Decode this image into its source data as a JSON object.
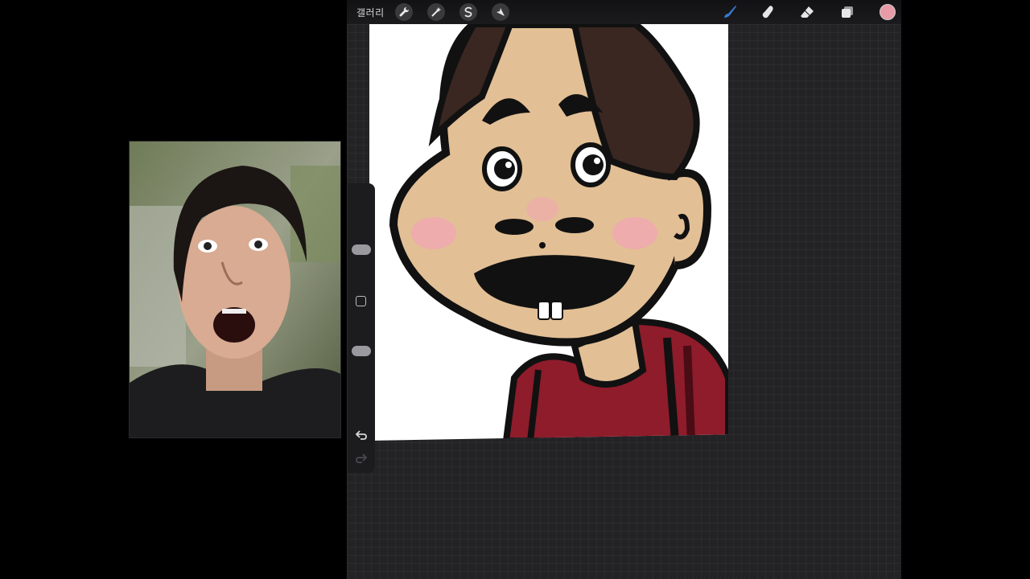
{
  "toolbar": {
    "gallery_label": "갤러리",
    "left_tools": [
      {
        "name": "actions",
        "icon": "wrench-icon"
      },
      {
        "name": "adjustments",
        "icon": "magic-wand-icon"
      },
      {
        "name": "selection",
        "icon": "selection-s-icon"
      },
      {
        "name": "transform",
        "icon": "arrow-cursor-icon"
      }
    ],
    "right_tools": [
      {
        "name": "brush",
        "icon": "brush-icon",
        "active": true
      },
      {
        "name": "smudge",
        "icon": "smudge-icon"
      },
      {
        "name": "eraser",
        "icon": "eraser-icon"
      },
      {
        "name": "layers",
        "icon": "layers-icon"
      }
    ],
    "active_color": "#e89aa6",
    "active_tool_color": "#3a7bd5"
  },
  "sidebar": {
    "brush_size_level": 0.73,
    "opacity_level": 0.35,
    "icons": [
      "modify-square-icon",
      "undo-icon",
      "redo-icon"
    ]
  },
  "canvas": {
    "background": "#ffffff",
    "skin_color": "#e2bf95",
    "hair_color": "#3a2722",
    "shirt_color": "#8e1c2b",
    "blush_color": "#f1a8b1"
  }
}
